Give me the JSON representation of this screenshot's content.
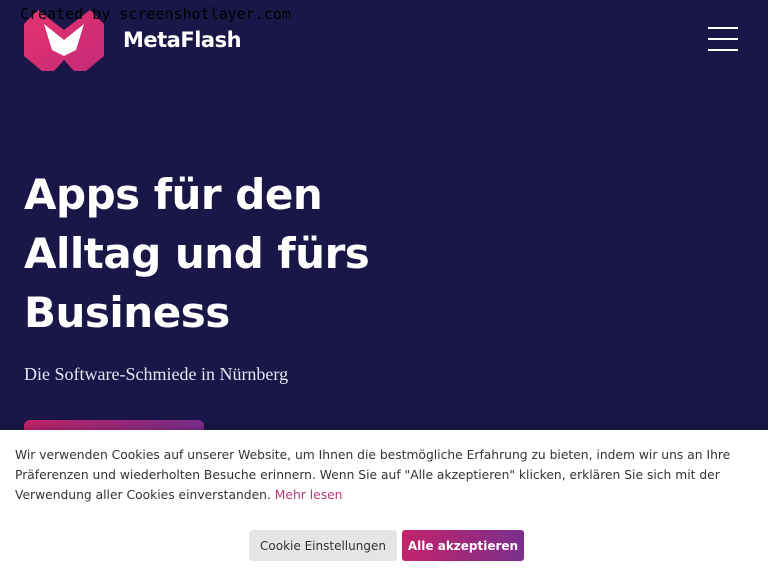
{
  "watermark": "Created by screenshotlayer.com",
  "header": {
    "brand": "MetaFlash",
    "logo_icon": "metaflash-logo-icon",
    "menu_icon": "hamburger-menu-icon"
  },
  "hero": {
    "title_lines": [
      "Apps für den",
      "Alltag und fürs",
      "Business"
    ],
    "subtitle": "Die Software-Schmiede in Nürnberg"
  },
  "cookie_banner": {
    "text": "Wir verwenden Cookies auf unserer Website, um Ihnen die bestmögliche Erfahrung zu bieten, indem wir uns an Ihre Präferenzen und wiederholten Besuche erinnern. Wenn Sie auf \"Alle akzeptieren\" klicken, erklären Sie sich mit der Verwendung aller Cookies einverstanden.",
    "read_more": "Mehr lesen",
    "settings_label": "Cookie Einstellungen",
    "accept_label": "Alle akzeptieren"
  },
  "colors": {
    "background": "#1a1748",
    "accent_start": "#c4246a",
    "accent_end": "#7a2f8d",
    "link": "#b43a76"
  }
}
